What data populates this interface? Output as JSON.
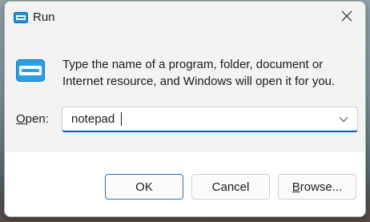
{
  "window": {
    "title": "Run",
    "icon": "run-icon",
    "close_icon": "close-icon"
  },
  "description": {
    "line1": "Type the name of a program, folder, document or",
    "line2": "Internet resource, and Windows will open it for you."
  },
  "open_field": {
    "label_mnemonic": "O",
    "label_rest": "pen:",
    "value": "notepad",
    "dropdown_icon": "chevron-down-icon"
  },
  "buttons": {
    "ok": "OK",
    "cancel": "Cancel",
    "browse_mnemonic": "B",
    "browse_rest": "rowse..."
  },
  "colors": {
    "accent": "#005fb8",
    "dialog_bg": "#f3f3f3",
    "footer_bg": "#ffffff"
  }
}
